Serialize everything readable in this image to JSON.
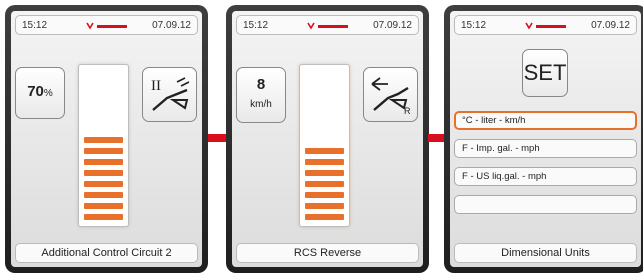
{
  "status": {
    "time": "15:12",
    "date": "07.09.12"
  },
  "screens": [
    {
      "value": "70",
      "unit": "%",
      "level_segments": 8,
      "total_segments": 13,
      "footer": "Additional Control Circuit 2",
      "icon": "hydraulic-circuit-2-icon",
      "icon_roman": "II"
    },
    {
      "value": "8",
      "unit": "km/h",
      "level_segments": 7,
      "total_segments": 13,
      "footer": "RCS Reverse",
      "icon": "rcs-reverse-icon",
      "icon_sub": "R"
    },
    {
      "title": "SET",
      "options": [
        {
          "label": "°C - liter - km/h",
          "selected": true
        },
        {
          "label": "F - Imp. gal. - mph",
          "selected": false
        },
        {
          "label": "F - US liq.gal. - mph",
          "selected": false
        },
        {
          "label": "",
          "selected": false
        }
      ],
      "footer": "Dimensional Units"
    }
  ],
  "colors": {
    "accent": "#e8702a",
    "connector": "#d80f1c",
    "frame": "#2a2a2a"
  }
}
